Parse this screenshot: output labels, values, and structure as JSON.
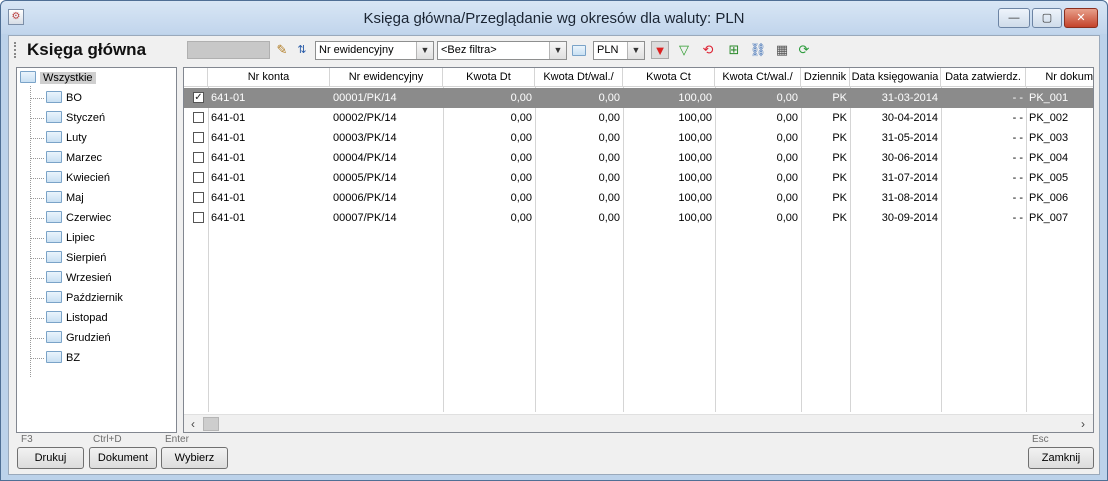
{
  "window": {
    "title": "Księga główna/Przeglądanie wg okresów dla waluty: PLN",
    "minimize": "—",
    "maximize": "▢",
    "close": "✕"
  },
  "toolbar": {
    "module_title": "Księga główna",
    "sort_combo": "Nr ewidencyjny",
    "filter_combo": "<Bez filtra>",
    "currency_combo": "PLN",
    "icons": [
      "eraser-icon",
      "sort-icon",
      "folder-icon",
      "filter-red-icon",
      "filter-green-icon",
      "refresh-red-icon",
      "add-icon",
      "link-icon",
      "grid-icon",
      "refresh-green-icon"
    ]
  },
  "tree": {
    "root": "Wszystkie",
    "items": [
      "BO",
      "Styczeń",
      "Luty",
      "Marzec",
      "Kwiecień",
      "Maj",
      "Czerwiec",
      "Lipiec",
      "Sierpień",
      "Wrzesień",
      "Październik",
      "Listopad",
      "Grudzień",
      "BZ"
    ]
  },
  "grid": {
    "columns": [
      "Nr konta",
      "Nr ewidencyjny",
      "Kwota Dt",
      "Kwota Dt/wal./",
      "Kwota Ct",
      "Kwota Ct/wal./",
      "Dziennik",
      "Data księgowania",
      "Data zatwierdz.",
      "Nr dokum"
    ],
    "rows": [
      {
        "checked": true,
        "konto": "641-01",
        "ewid": "00001/PK/14",
        "dt": "0,00",
        "dtw": "0,00",
        "ct": "100,00",
        "ctw": "0,00",
        "dziennik": "PK",
        "data_ks": "31-03-2014",
        "data_zat": "- -",
        "nr_dok": "PK_001"
      },
      {
        "checked": false,
        "konto": "641-01",
        "ewid": "00002/PK/14",
        "dt": "0,00",
        "dtw": "0,00",
        "ct": "100,00",
        "ctw": "0,00",
        "dziennik": "PK",
        "data_ks": "30-04-2014",
        "data_zat": "- -",
        "nr_dok": "PK_002"
      },
      {
        "checked": false,
        "konto": "641-01",
        "ewid": "00003/PK/14",
        "dt": "0,00",
        "dtw": "0,00",
        "ct": "100,00",
        "ctw": "0,00",
        "dziennik": "PK",
        "data_ks": "31-05-2014",
        "data_zat": "- -",
        "nr_dok": "PK_003"
      },
      {
        "checked": false,
        "konto": "641-01",
        "ewid": "00004/PK/14",
        "dt": "0,00",
        "dtw": "0,00",
        "ct": "100,00",
        "ctw": "0,00",
        "dziennik": "PK",
        "data_ks": "30-06-2014",
        "data_zat": "- -",
        "nr_dok": "PK_004"
      },
      {
        "checked": false,
        "konto": "641-01",
        "ewid": "00005/PK/14",
        "dt": "0,00",
        "dtw": "0,00",
        "ct": "100,00",
        "ctw": "0,00",
        "dziennik": "PK",
        "data_ks": "31-07-2014",
        "data_zat": "- -",
        "nr_dok": "PK_005"
      },
      {
        "checked": false,
        "konto": "641-01",
        "ewid": "00006/PK/14",
        "dt": "0,00",
        "dtw": "0,00",
        "ct": "100,00",
        "ctw": "0,00",
        "dziennik": "PK",
        "data_ks": "31-08-2014",
        "data_zat": "- -",
        "nr_dok": "PK_006"
      },
      {
        "checked": false,
        "konto": "641-01",
        "ewid": "00007/PK/14",
        "dt": "0,00",
        "dtw": "0,00",
        "ct": "100,00",
        "ctw": "0,00",
        "dziennik": "PK",
        "data_ks": "30-09-2014",
        "data_zat": "- -",
        "nr_dok": "PK_007"
      }
    ]
  },
  "footer": {
    "print": {
      "shortcut": "F3",
      "label": "Drukuj"
    },
    "document": {
      "shortcut": "Ctrl+D",
      "label": "Dokument"
    },
    "select": {
      "shortcut": "Enter",
      "label": "Wybierz"
    },
    "close": {
      "shortcut": "Esc",
      "label": "Zamknij"
    }
  },
  "colors": {
    "selected_row": "#8b8b8b",
    "titlebar": "#c1d5ec",
    "window_frame": "#bcd2ea"
  }
}
